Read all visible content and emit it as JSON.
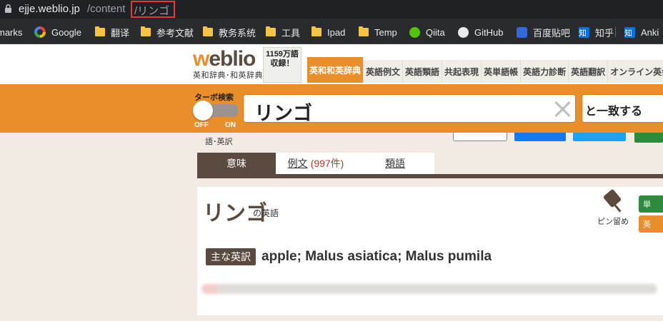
{
  "browser": {
    "url_host": "ejje.weblio.jp",
    "url_path": "/content",
    "url_query": "/リンゴ"
  },
  "bookmarks": [
    {
      "label": "marks",
      "icon": "none"
    },
    {
      "label": "Google",
      "icon": "google-icon"
    },
    {
      "label": "翻译",
      "icon": "folder-icon"
    },
    {
      "label": "参考文献",
      "icon": "folder-icon"
    },
    {
      "label": "教务系统",
      "icon": "folder-icon"
    },
    {
      "label": "工具",
      "icon": "folder-icon"
    },
    {
      "label": "Ipad",
      "icon": "folder-icon"
    },
    {
      "label": "Temp",
      "icon": "folder-icon"
    },
    {
      "label": "Qiita",
      "icon": "qiita-icon"
    },
    {
      "label": "GitHub",
      "icon": "github-icon"
    },
    {
      "label": "百度贴吧",
      "icon": "paw-icon"
    },
    {
      "label": "知乎",
      "icon": "zhihu-icon"
    },
    {
      "label": "Anki",
      "icon": "zhihu-icon"
    }
  ],
  "header": {
    "logo_text": "weblio",
    "logo_subtitle": "英和辞典･和英辞典",
    "count_badge": "1159万語収録！",
    "nav_tabs": [
      "英和和英辞典",
      "英語例文",
      "英語類語",
      "共起表現",
      "英単語帳",
      "英語力診断",
      "英語翻訳",
      "オンライン英会話"
    ]
  },
  "search": {
    "turbo_label": "ターボ検索",
    "toggle_off": "OFF",
    "toggle_on": "ON",
    "query": "リンゴ",
    "match_mode": "と一致する"
  },
  "sub_strip": {
    "crumb_tail": "語･英訳"
  },
  "content_tabs": {
    "meaning": "意味",
    "examples": "例文",
    "examples_count": "(997件)",
    "synonyms": "類語"
  },
  "entry": {
    "headword": "リンゴ",
    "headword_suffix": "の英語",
    "pin_label": "ピン留め",
    "side_green": "単",
    "side_orange": "英",
    "main_label": "主な英訳",
    "main_translation": "apple; Malus asiatica; Malus pumila"
  },
  "colors": {
    "accent_orange": "#e88e2a",
    "brand_brown": "#5a4a3f",
    "highlight_red": "#e53935"
  }
}
